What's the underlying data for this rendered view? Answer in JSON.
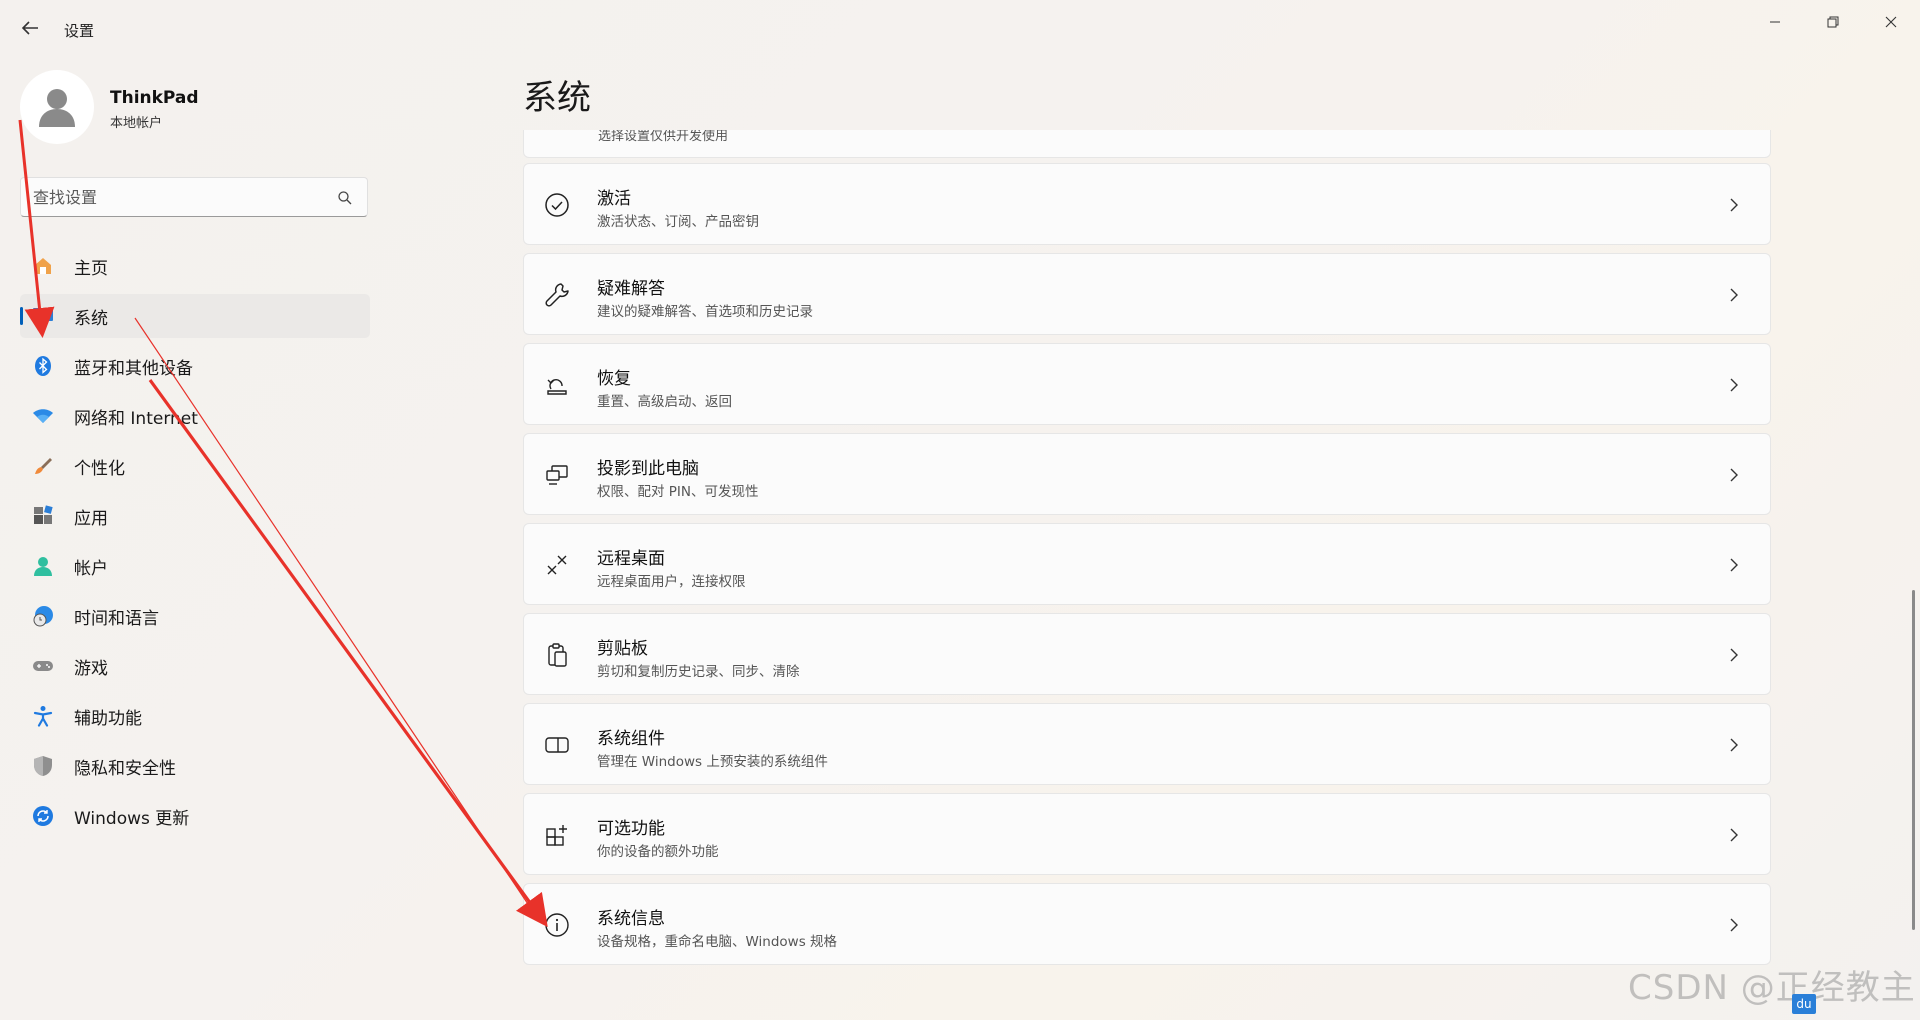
{
  "window": {
    "title": "设置"
  },
  "profile": {
    "name": "ThinkPad",
    "account_type": "本地帐户"
  },
  "search": {
    "placeholder": "查找设置"
  },
  "sidebar": {
    "items": [
      {
        "label": "主页",
        "icon": "home-icon"
      },
      {
        "label": "系统",
        "icon": "system-icon",
        "active": true
      },
      {
        "label": "蓝牙和其他设备",
        "icon": "bluetooth-icon"
      },
      {
        "label": "网络和 Internet",
        "icon": "wifi-icon"
      },
      {
        "label": "个性化",
        "icon": "brush-icon"
      },
      {
        "label": "应用",
        "icon": "apps-icon"
      },
      {
        "label": "帐户",
        "icon": "account-icon"
      },
      {
        "label": "时间和语言",
        "icon": "globe-clock-icon"
      },
      {
        "label": "游戏",
        "icon": "gamepad-icon"
      },
      {
        "label": "辅助功能",
        "icon": "accessibility-icon"
      },
      {
        "label": "隐私和安全性",
        "icon": "shield-icon"
      },
      {
        "label": "Windows 更新",
        "icon": "update-icon"
      }
    ]
  },
  "main": {
    "page_title": "系统",
    "partial_card_subtitle": "选择设置仅供开发使用",
    "cards": [
      {
        "title": "激活",
        "subtitle": "激活状态、订阅、产品密钥",
        "icon": "check-circle-icon"
      },
      {
        "title": "疑难解答",
        "subtitle": "建议的疑难解答、首选项和历史记录",
        "icon": "wrench-icon"
      },
      {
        "title": "恢复",
        "subtitle": "重置、高级启动、返回",
        "icon": "recovery-icon"
      },
      {
        "title": "投影到此电脑",
        "subtitle": "权限、配对 PIN、可发现性",
        "icon": "project-icon"
      },
      {
        "title": "远程桌面",
        "subtitle": "远程桌面用户，连接权限",
        "icon": "remote-desktop-icon"
      },
      {
        "title": "剪贴板",
        "subtitle": "剪切和复制历史记录、同步、清除",
        "icon": "clipboard-icon"
      },
      {
        "title": "系统组件",
        "subtitle": "管理在 Windows 上预安装的系统组件",
        "icon": "components-icon"
      },
      {
        "title": "可选功能",
        "subtitle": "你的设备的额外功能",
        "icon": "optional-features-icon"
      },
      {
        "title": "系统信息",
        "subtitle": "设备规格，重命名电脑、Windows 规格",
        "icon": "info-icon"
      }
    ]
  },
  "watermark": {
    "text": "CSDN @正经教主",
    "badge": "du"
  },
  "colors": {
    "accent": "#005fb8",
    "annotation_arrow": "#e8322a"
  }
}
